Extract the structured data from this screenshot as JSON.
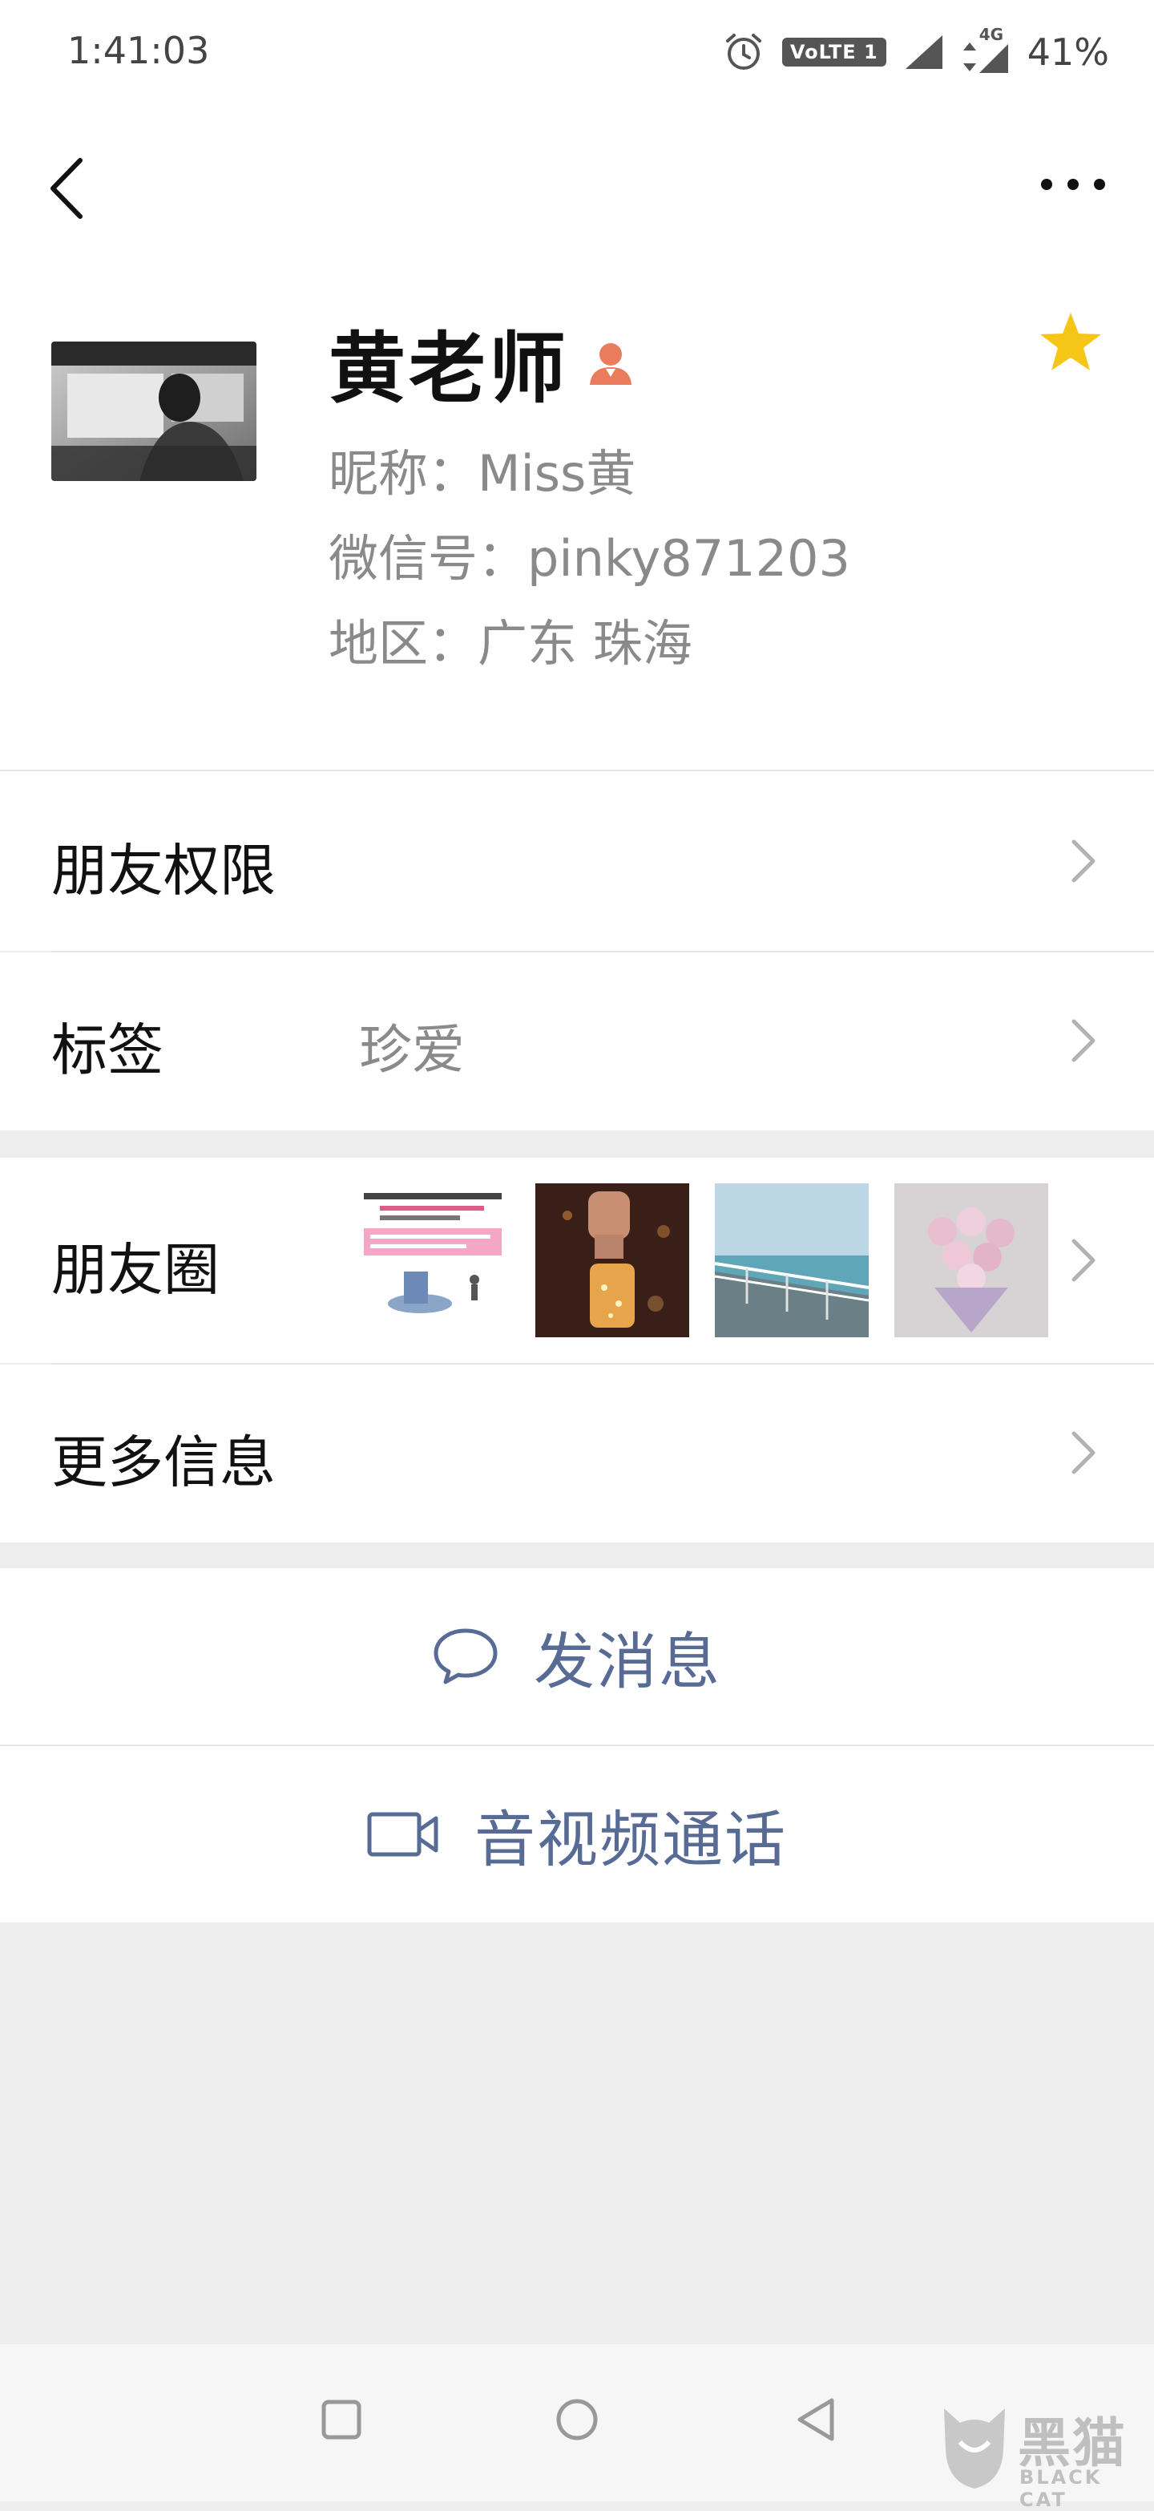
{
  "status_bar": {
    "time": "1:41:03",
    "network_badge": "VoLTE 1",
    "network_type": "4G",
    "battery": "41%"
  },
  "profile": {
    "name": "黄老师",
    "nickname": "昵称：Miss黄",
    "wechat_id": "微信号：pinky871203",
    "region": "地区：广东  珠海"
  },
  "rows": {
    "friend_permissions": "朋友权限",
    "tags_label": "标签",
    "tags_value": "珍爱",
    "moments": "朋友圈",
    "more_info": "更多信息"
  },
  "actions": {
    "send_message": "发消息",
    "video_call": "音视频通话"
  },
  "watermark": {
    "text_cn": "黑猫",
    "text_en": "BLACK CAT"
  },
  "colors": {
    "link": "#576b95",
    "star": "#f5c518",
    "person_icon": "#e97c5c"
  },
  "icons": {
    "back": "chevron-left-icon",
    "more": "ellipsis-icon",
    "star": "star-icon",
    "chat": "chat-bubble-icon",
    "video": "video-camera-icon"
  }
}
